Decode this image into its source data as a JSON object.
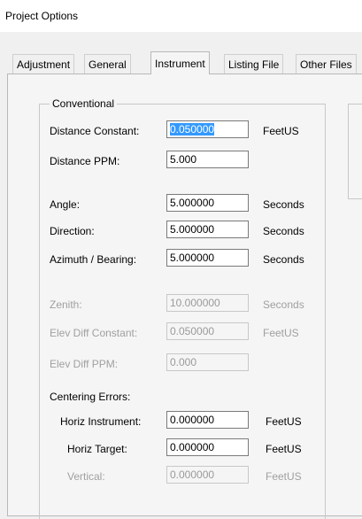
{
  "window": {
    "title": "Project Options"
  },
  "tabs": [
    {
      "label": "Adjustment",
      "selected": false
    },
    {
      "label": "General",
      "selected": false
    },
    {
      "label": "Instrument",
      "selected": true
    },
    {
      "label": "Listing File",
      "selected": false
    },
    {
      "label": "Other Files",
      "selected": false
    }
  ],
  "group": {
    "label": "Conventional",
    "rows": [
      {
        "label": "Distance Constant:",
        "value": "0.050000",
        "unit": "FeetUS",
        "enabled": true,
        "selected_text": true
      },
      {
        "label": "Distance PPM:",
        "value": "5.000",
        "unit": "",
        "enabled": true
      },
      {
        "label": "Angle:",
        "value": "5.000000",
        "unit": "Seconds",
        "enabled": true
      },
      {
        "label": "Direction:",
        "value": "5.000000",
        "unit": "Seconds",
        "enabled": true
      },
      {
        "label": "Azimuth / Bearing:",
        "value": "5.000000",
        "unit": "Seconds",
        "enabled": true
      },
      {
        "label": "Zenith:",
        "value": "10.000000",
        "unit": "Seconds",
        "enabled": false
      },
      {
        "label": "Elev Diff Constant:",
        "value": "0.050000",
        "unit": "FeetUS",
        "enabled": false
      },
      {
        "label": "Elev Diff PPM:",
        "value": "0.000",
        "unit": "",
        "enabled": false
      }
    ],
    "centering": {
      "label": "Centering Errors:",
      "rows": [
        {
          "label": "Horiz Instrument:",
          "value": "0.000000",
          "unit": "FeetUS",
          "enabled": true
        },
        {
          "label": "Horiz Target:",
          "value": "0.000000",
          "unit": "FeetUS",
          "enabled": true
        },
        {
          "label": "Vertical:",
          "value": "0.000000",
          "unit": "FeetUS",
          "enabled": false
        }
      ]
    }
  }
}
